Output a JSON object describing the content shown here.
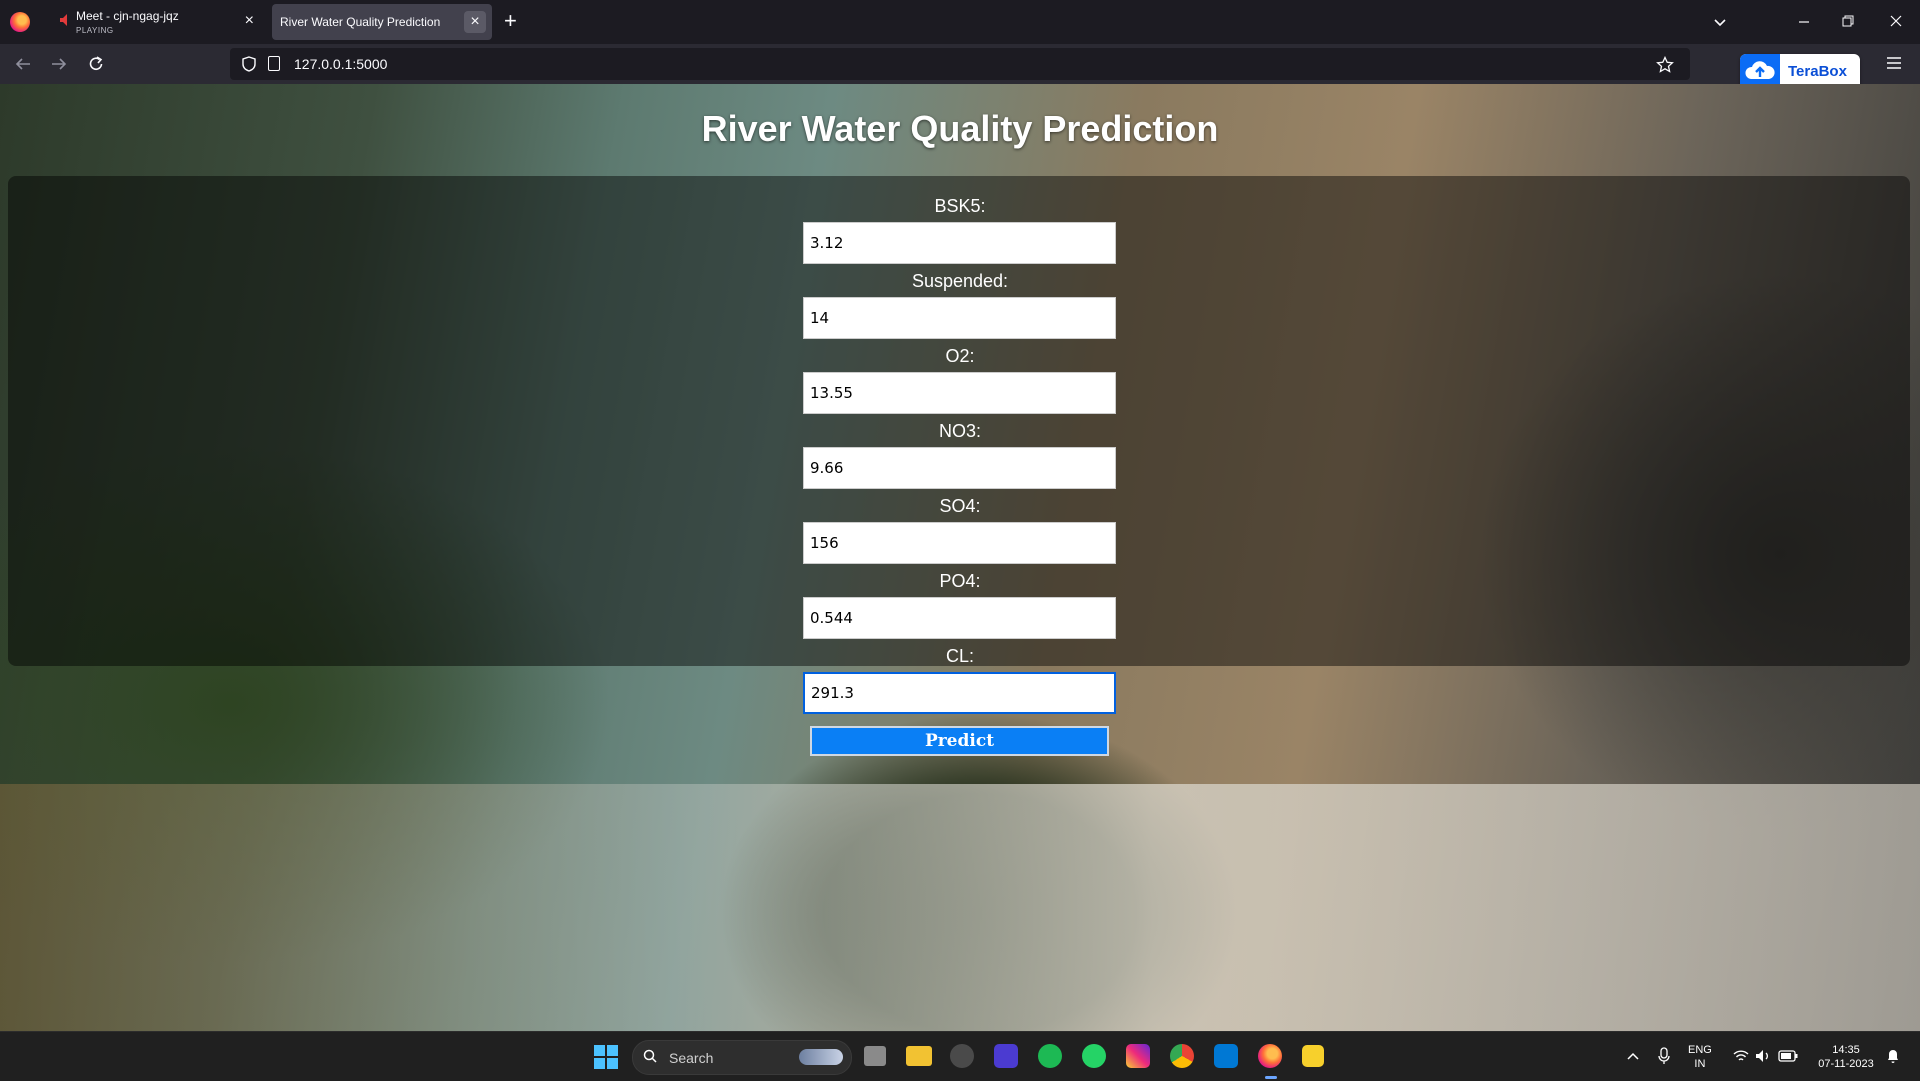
{
  "browser": {
    "tabs": [
      {
        "title": "Meet - cjn-ngag-jqz",
        "subtitle": "PLAYING",
        "close": "×"
      },
      {
        "title": "River Water Quality Prediction",
        "close": "×"
      }
    ],
    "new_tab": "+",
    "url": "127.0.0.1:5000",
    "extension_label": "TeraBox"
  },
  "page": {
    "title": "River Water Quality Prediction",
    "fields": [
      {
        "label": "BSK5:",
        "value": "3.12"
      },
      {
        "label": "Suspended:",
        "value": "14"
      },
      {
        "label": "O2:",
        "value": "13.55"
      },
      {
        "label": "NO3:",
        "value": "9.66"
      },
      {
        "label": "SO4:",
        "value": "156"
      },
      {
        "label": "PO4:",
        "value": "0.544"
      },
      {
        "label": "CL:",
        "value": "291.3"
      }
    ],
    "predict_label": "Predict"
  },
  "taskbar": {
    "search_placeholder": "Search",
    "language": "ENG",
    "region": "IN",
    "time": "14:35",
    "date": "07-11-2023"
  },
  "colors": {
    "accent": "#0a7ff5",
    "tab_active": "#42414d",
    "chrome_bg": "#1c1b22"
  }
}
